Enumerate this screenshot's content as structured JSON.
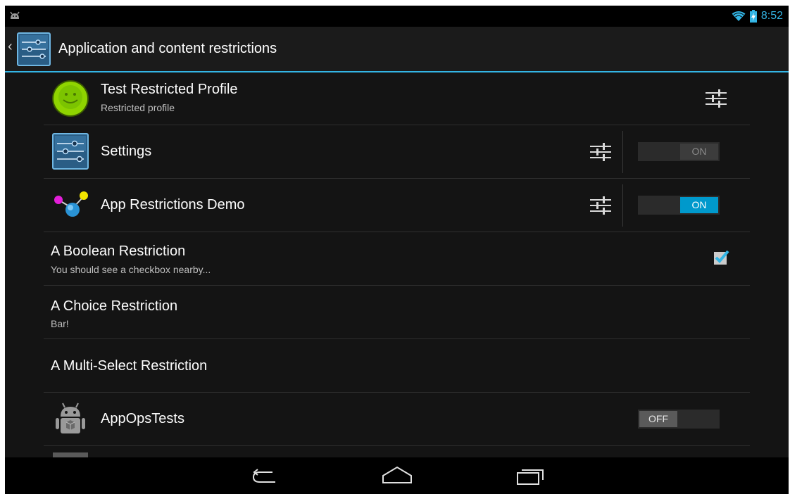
{
  "status_bar": {
    "time": "8:52",
    "icons": [
      "android-notification-icon",
      "wifi-icon",
      "battery-charging-icon"
    ]
  },
  "action_bar": {
    "title": "Application and content restrictions",
    "icons": [
      "back-caret-icon",
      "settings-sliders-icon"
    ]
  },
  "rows": [
    {
      "title": "Test Restricted Profile",
      "summary": "Restricted profile",
      "icon": "profile-avatar-icon",
      "action": "settings-sliders-icon"
    },
    {
      "title": "Settings",
      "icon": "settings-app-icon",
      "toggle": "ON",
      "toggle_state": "on-inactive"
    },
    {
      "title": "App Restrictions Demo",
      "icon": "app-restrictions-demo-icon",
      "toggle": "ON",
      "toggle_state": "on"
    },
    {
      "title": "A Boolean Restriction",
      "summary": "You should see a checkbox nearby...",
      "checked": true
    },
    {
      "title": "A Choice Restriction",
      "summary": "Bar!"
    },
    {
      "title": "A Multi-Select Restriction"
    },
    {
      "title": "AppOpsTests",
      "icon": "android-robot-icon",
      "toggle": "OFF",
      "toggle_state": "off"
    }
  ],
  "nav_bar": {
    "buttons": [
      "back-icon",
      "home-icon",
      "recent-apps-icon"
    ]
  },
  "colors": {
    "accent": "#33b5e5",
    "background": "#141414",
    "toggle_on": "#0099cc",
    "toggle_off_knob": "#5a5a5a"
  }
}
